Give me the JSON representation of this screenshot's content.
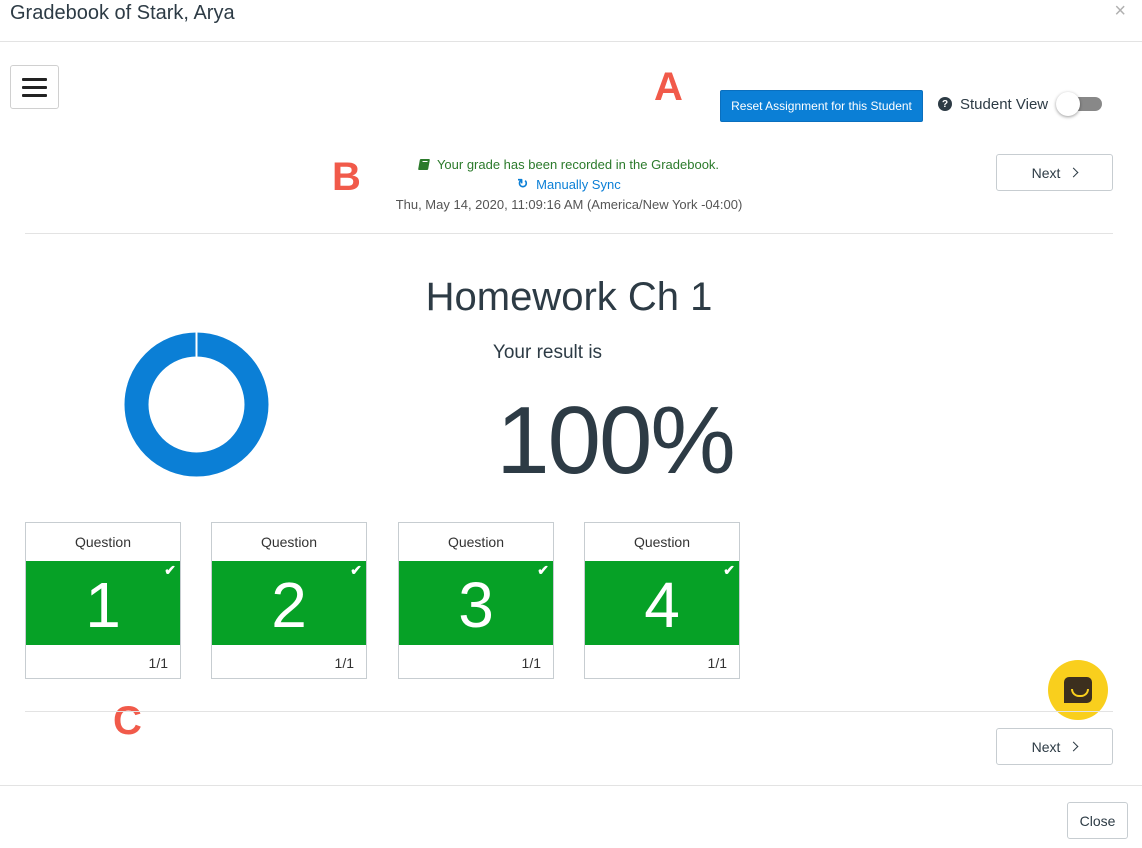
{
  "modal": {
    "title": "Gradebook of Stark, Arya",
    "close_x": "×",
    "close_button": "Close"
  },
  "annotations": {
    "a": "A",
    "b": "B",
    "c": "C"
  },
  "toolbar": {
    "reset_label": "Reset Assignment for this Student",
    "help_glyph": "?",
    "student_view_label": "Student View",
    "student_view_on": false
  },
  "status": {
    "recorded": "Your grade has been recorded in the Gradebook.",
    "sync_label": "Manually Sync",
    "timestamp": "Thu, May 14, 2020, 11:09:16 AM (America/New York -04:00)"
  },
  "nav": {
    "next_label": "Next"
  },
  "result": {
    "assignment_title": "Homework Ch 1",
    "label": "Your result is",
    "value": "100%",
    "score_fraction": 1.0
  },
  "questions": [
    {
      "header": "Question",
      "number": "1",
      "score": "1/1",
      "check": "✔"
    },
    {
      "header": "Question",
      "number": "2",
      "score": "1/1",
      "check": "✔"
    },
    {
      "header": "Question",
      "number": "3",
      "score": "1/1",
      "check": "✔"
    },
    {
      "header": "Question",
      "number": "4",
      "score": "1/1",
      "check": "✔"
    }
  ],
  "colors": {
    "primary": "#0b7fd6",
    "correct": "#06a126",
    "success_text": "#2b7a2b",
    "annotation": "#f15a4a",
    "chat": "#f9cf1d"
  }
}
